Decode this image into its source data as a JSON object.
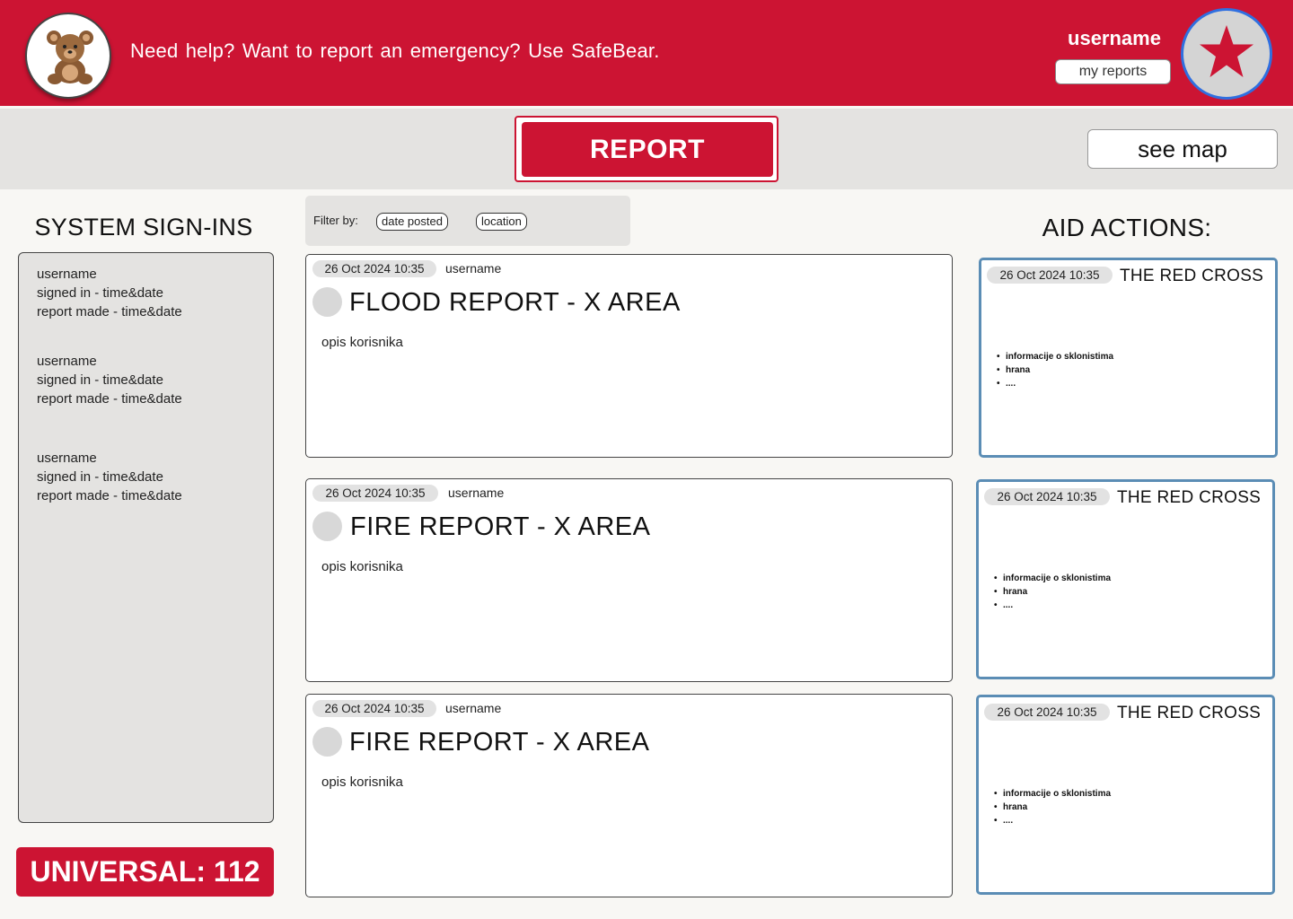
{
  "header": {
    "tagline": "Need help?  Want to report an emergency?  Use SafeBear.",
    "username": "username",
    "my_reports": "my reports",
    "logo_icon": "teddy-bear-icon",
    "avatar_icon": "star-icon",
    "brand_color": "#cc1433"
  },
  "toolbar": {
    "report_label": "REPORT",
    "see_map_label": "see map"
  },
  "signins": {
    "title": "SYSTEM SIGN-INS",
    "entries": [
      {
        "username": "username",
        "signed_in": "signed in - time&date",
        "report_made": "report made - time&date"
      },
      {
        "username": "username",
        "signed_in": "signed in - time&date",
        "report_made": "report made - time&date"
      },
      {
        "username": "username",
        "signed_in": "signed in - time&date",
        "report_made": "report made - time&date"
      }
    ]
  },
  "universal": "UNIVERSAL: 112",
  "filter": {
    "label": "Filter by:",
    "options": [
      "date posted",
      "location"
    ]
  },
  "reports": [
    {
      "date": "26 Oct 2024 10:35",
      "user": "username",
      "title": "FLOOD REPORT - X AREA",
      "desc": "opis korisnika"
    },
    {
      "date": "26 Oct 2024 10:35",
      "user": "username",
      "title": "FIRE REPORT - X AREA",
      "desc": "opis korisnika"
    },
    {
      "date": "26 Oct 2024 10:35",
      "user": "username",
      "title": "FIRE REPORT - X AREA",
      "desc": "opis korisnika"
    }
  ],
  "aid": {
    "title": "AID ACTIONS:",
    "items": [
      {
        "date": "26 Oct 2024 10:35",
        "org": "THE RED CROSS",
        "bullets": [
          "informacije o sklonistima",
          "hrana",
          "...."
        ]
      },
      {
        "date": "26 Oct 2024 10:35",
        "org": "THE RED CROSS",
        "bullets": [
          "informacije o sklonistima",
          "hrana",
          "...."
        ]
      },
      {
        "date": "26 Oct 2024 10:35",
        "org": "THE RED CROSS",
        "bullets": [
          "informacije o sklonistima",
          "hrana",
          "...."
        ]
      }
    ]
  }
}
